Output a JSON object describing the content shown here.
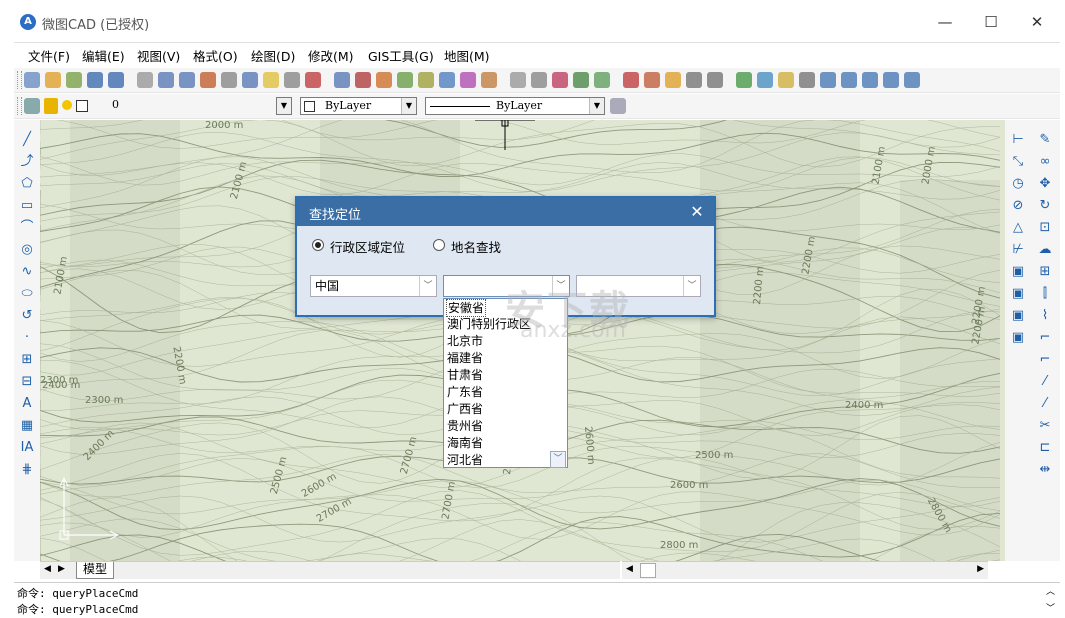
{
  "window": {
    "title": "微图CAD (已授权)",
    "app_icon_glyph": "A",
    "minimize_glyph": "—",
    "maximize_glyph": "☐",
    "close_glyph": "✕"
  },
  "menu": [
    "文件(F)",
    "编辑(E)",
    "视图(V)",
    "格式(O)",
    "绘图(D)",
    "修改(M)",
    "GIS工具(G)",
    "地图(M)"
  ],
  "layer_toolbar": {
    "layer_value": "0",
    "color_value": "ByLayer",
    "linetype_value": "ByLayer"
  },
  "contour_labels": [
    "2000 m",
    "2100 m",
    "2100 m",
    "2200 m",
    "2200 m",
    "2200 m",
    "2200 m",
    "2300 m",
    "2400 m",
    "2400 m",
    "2500 m",
    "2500 m",
    "2500 m",
    "2600 m",
    "2600 m",
    "2600 m",
    "2700 m",
    "2700 m",
    "2700 m",
    "2800 m",
    "2800 m",
    "2400 m",
    "2300 m",
    "2100 m",
    "2000 m",
    "2200 m"
  ],
  "dialog": {
    "title": "查找定位",
    "close_glyph": "✕",
    "radio_admin": "行政区域定位",
    "radio_name": "地名查找",
    "country_value": "中国",
    "province_value": "",
    "city_value": ""
  },
  "province_list": [
    "安徽省",
    "澳门特别行政区",
    "北京市",
    "福建省",
    "甘肃省",
    "广东省",
    "广西省",
    "贵州省",
    "海南省",
    "河北省"
  ],
  "watermark": {
    "big": "安下载",
    "small": "anxz.com"
  },
  "tabs": {
    "model_tab": "模型"
  },
  "command": {
    "line1": "命令: queryPlaceCmd",
    "line2": "命令: queryPlaceCmd"
  }
}
